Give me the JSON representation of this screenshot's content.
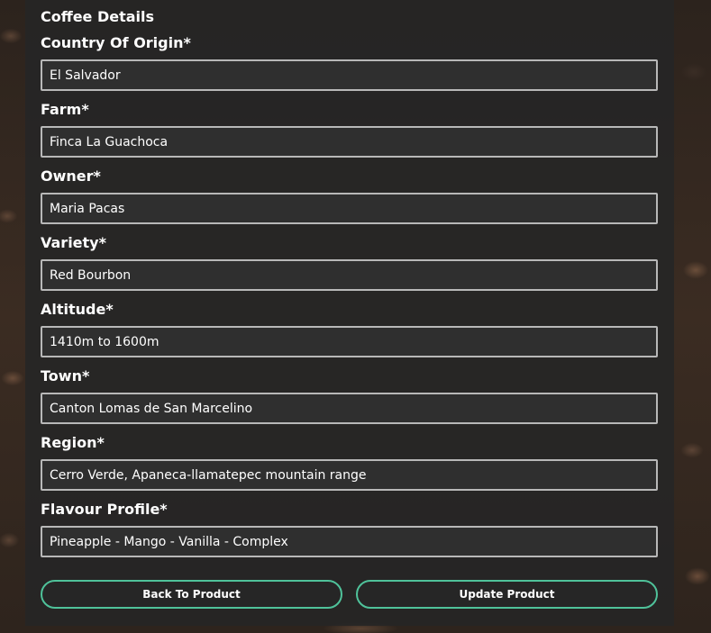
{
  "form": {
    "section_title": "Coffee Details",
    "fields": [
      {
        "label": "Country Of Origin*",
        "value": "El Salvador"
      },
      {
        "label": "Farm*",
        "value": "Finca La Guachoca"
      },
      {
        "label": "Owner*",
        "value": "Maria Pacas"
      },
      {
        "label": "Variety*",
        "value": "Red Bourbon"
      },
      {
        "label": "Altitude*",
        "value": "1410m to 1600m"
      },
      {
        "label": "Town*",
        "value": "Canton Lomas de San Marcelino"
      },
      {
        "label": "Region*",
        "value": "Cerro Verde, Apaneca-llamatepec mountain range"
      },
      {
        "label": "Flavour Profile*",
        "value": "Pineapple - Mango - Vanilla - Complex"
      }
    ]
  },
  "actions": {
    "back_label": "Back To Product",
    "update_label": "Update Product"
  },
  "colors": {
    "accent": "#4fc29a",
    "panel": "#262626",
    "input_border": "#b8b8b8"
  }
}
